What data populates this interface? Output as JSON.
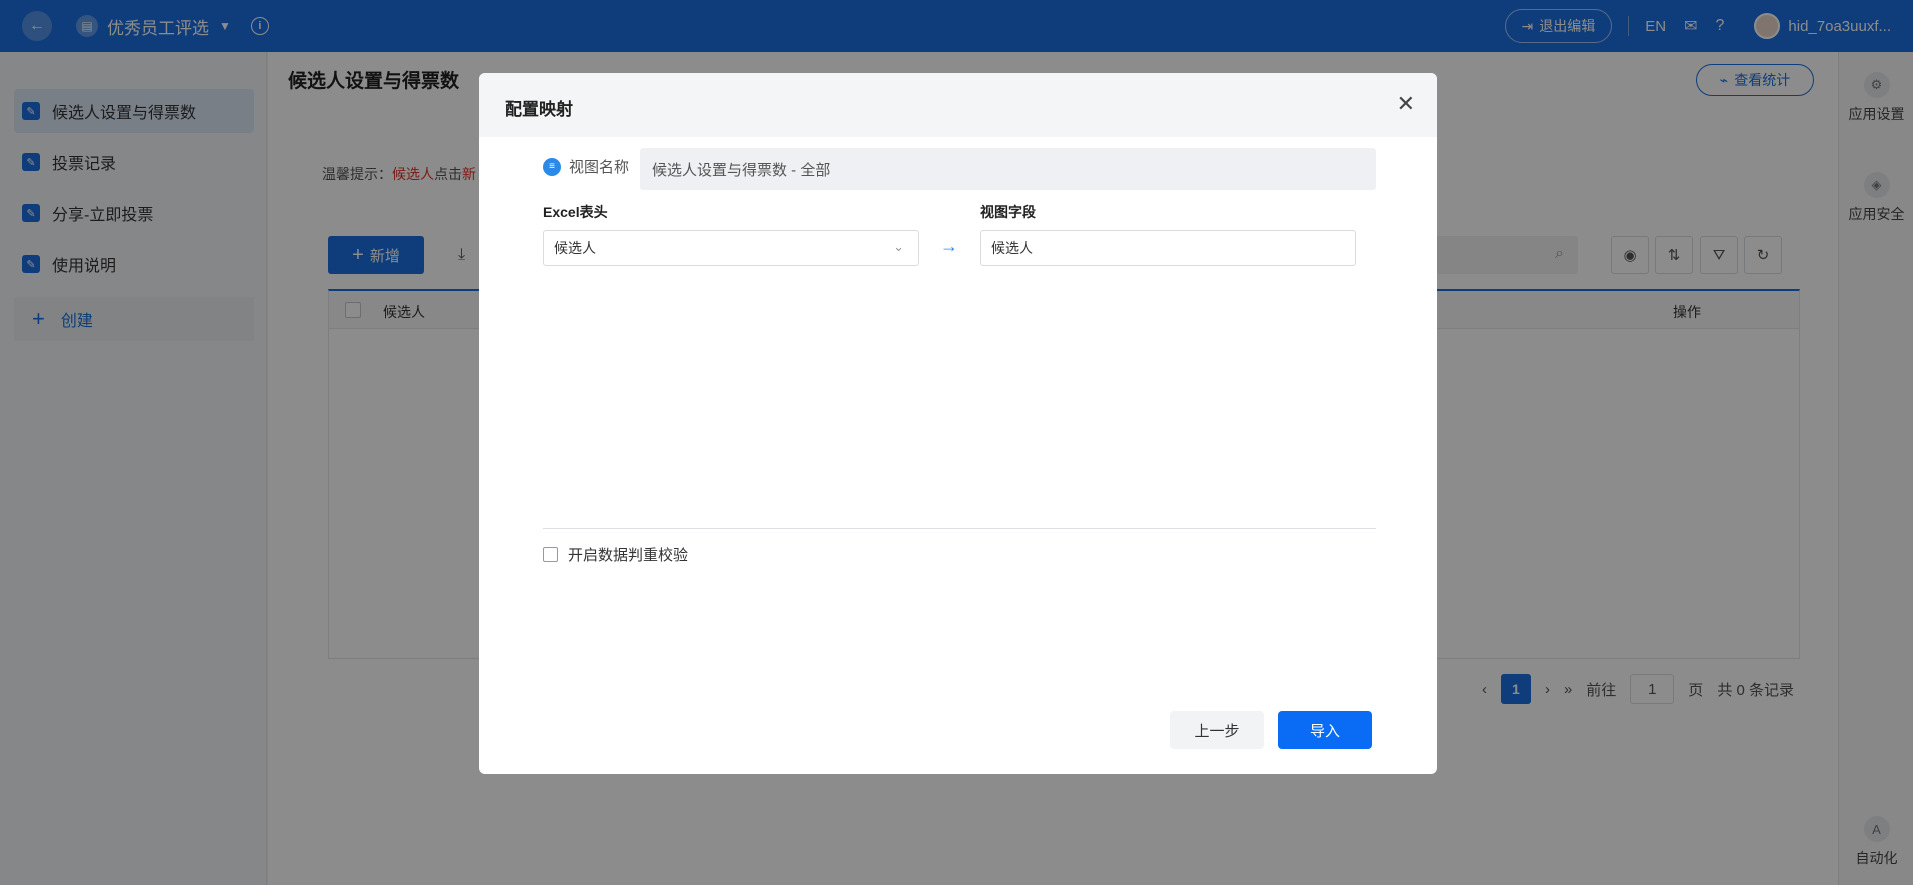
{
  "topbar": {
    "app_title": "优秀员工评选",
    "exit_edit": "退出编辑",
    "lang": "EN",
    "user_name": "hid_7oa3uuxf..."
  },
  "sidebar": {
    "items": [
      {
        "label": "候选人设置与得票数"
      },
      {
        "label": "投票记录"
      },
      {
        "label": "分享-立即投票"
      },
      {
        "label": "使用说明"
      }
    ],
    "create_label": "创建"
  },
  "main": {
    "page_title": "候选人设置与得票数",
    "stat_button": "查看统计",
    "tip_prefix": "温馨提示：",
    "tip_red": "候选人",
    "tip_text": "点击",
    "tip_red2": "新",
    "add_button": "新增",
    "table": {
      "col_candidate": "候选人",
      "col_operation": "操作"
    },
    "pager": {
      "current": "1",
      "goto": "前往",
      "page_input": "1",
      "page_unit": "页",
      "total": "共 0 条记录"
    }
  },
  "rail": {
    "items": [
      {
        "label": "应用设置"
      },
      {
        "label": "应用安全"
      },
      {
        "label": "自动化"
      }
    ]
  },
  "modal": {
    "title": "配置映射",
    "view_name_label": "视图名称",
    "view_name_value": "候选人设置与得票数 - 全部",
    "excel_header_label": "Excel表头",
    "view_field_label": "视图字段",
    "excel_header_value": "候选人",
    "view_field_value": "候选人",
    "dedupe_label": "开启数据判重校验",
    "prev_button": "上一步",
    "import_button": "导入"
  },
  "colors": {
    "primary": "#1d6fe0",
    "import_button": "#0a6cf5"
  }
}
